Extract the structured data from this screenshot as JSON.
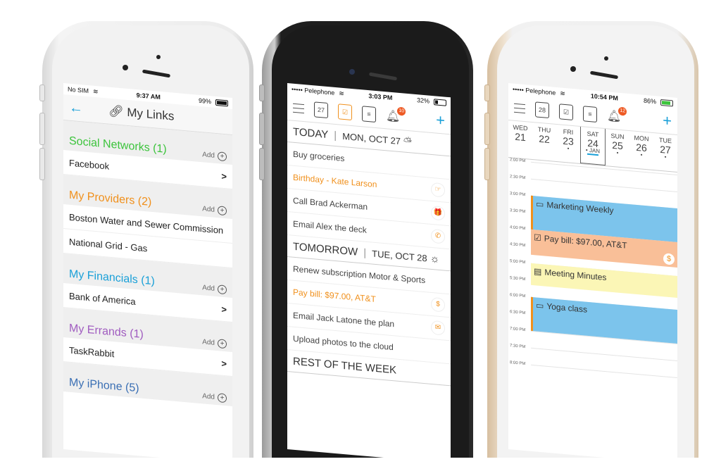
{
  "phone1": {
    "status": {
      "carrier": "No SIM",
      "time": "9:37 AM",
      "battery": "99%"
    },
    "nav": {
      "back_icon": "arrow-left-icon",
      "title_icon": "link-icon",
      "title": "My Links"
    },
    "sections": [
      {
        "name": "Social Networks (1)",
        "color": "#3cc43c",
        "add": "Add",
        "items": [
          {
            "label": "Facebook",
            "chevron": ">"
          }
        ]
      },
      {
        "name": "My Providers (2)",
        "color": "#f0901c",
        "add": "Add",
        "items": [
          {
            "label": "Boston Water and Sewer Commission",
            "chevron": ""
          },
          {
            "label": "National Grid - Gas",
            "chevron": ""
          }
        ]
      },
      {
        "name": "My Financials (1)",
        "color": "#1aa0d8",
        "add": "Add",
        "items": [
          {
            "label": "Bank of America",
            "chevron": ">"
          }
        ]
      },
      {
        "name": "My Errands (1)",
        "color": "#a05cc0",
        "add": "Add",
        "items": [
          {
            "label": "TaskRabbit",
            "chevron": ">"
          }
        ]
      },
      {
        "name": "My iPhone (5)",
        "color": "#3a6fb4",
        "add": "Add",
        "items": []
      }
    ]
  },
  "phone2": {
    "status": {
      "carrier": "••••• Pelephone",
      "time": "3:03 PM",
      "battery": "32%"
    },
    "nav": {
      "calendar_day": "27",
      "badge": "10",
      "add": "+"
    },
    "today": {
      "label": "TODAY",
      "date": "MON, OCT 27"
    },
    "today_tasks": [
      {
        "label": "Buy groceries",
        "icon": "",
        "hl": false
      },
      {
        "label": "Birthday - Kate Larson",
        "icon": "☞",
        "hl": true
      },
      {
        "label": "Call Brad Ackerman",
        "icon": "🎁",
        "hl": false
      },
      {
        "label": "Email Alex the deck",
        "icon": "✆",
        "hl": false
      }
    ],
    "tomorrow": {
      "label": "TOMORROW",
      "date": "TUE, OCT 28"
    },
    "tomorrow_tasks": [
      {
        "label": "Renew subscription Motor & Sports",
        "icon": "",
        "hl": false
      },
      {
        "label": "Pay bill: $97.00, AT&T",
        "icon": "$",
        "hl": true
      },
      {
        "label": "Email Jack Latone the plan",
        "icon": "✉",
        "hl": false
      },
      {
        "label": "Upload photos to the cloud",
        "icon": "",
        "hl": false
      }
    ],
    "rest": {
      "label": "REST OF THE WEEK"
    }
  },
  "phone3": {
    "status": {
      "carrier": "••••• Pelephone",
      "time": "10:54 PM",
      "battery": "86%"
    },
    "nav": {
      "calendar_day": "28",
      "badge": "12",
      "add": "+"
    },
    "days": [
      {
        "dn": "WED",
        "dd": "21",
        "dot": ""
      },
      {
        "dn": "THU",
        "dd": "22",
        "dot": ""
      },
      {
        "dn": "FRI",
        "dd": "23",
        "dot": "•"
      },
      {
        "dn": "SAT",
        "dd": "24",
        "dot": "• JAN",
        "selected": true
      },
      {
        "dn": "SUN",
        "dd": "25",
        "dot": "•"
      },
      {
        "dn": "MON",
        "dd": "26",
        "dot": "•"
      },
      {
        "dn": "TUE",
        "dd": "27",
        "dot": "•"
      }
    ],
    "times": [
      "2:00 PM",
      "2:30 PM",
      "3:00 PM",
      "3:30 PM",
      "4:00 PM",
      "4:30 PM",
      "5:00 PM",
      "5:30 PM",
      "6:00 PM",
      "6:30 PM",
      "7:00 PM",
      "7:30 PM",
      "8:00 PM"
    ],
    "events": [
      {
        "label": "Marketing Weekly",
        "icon": "▭",
        "type": "blue"
      },
      {
        "label": "Pay bill: $97.00, AT&T",
        "icon": "☑",
        "type": "orange",
        "extra": "$"
      },
      {
        "label": "Meeting Minutes",
        "icon": "▤",
        "type": "yellow"
      },
      {
        "label": "Yoga class",
        "icon": "▭",
        "type": "blue"
      }
    ]
  }
}
